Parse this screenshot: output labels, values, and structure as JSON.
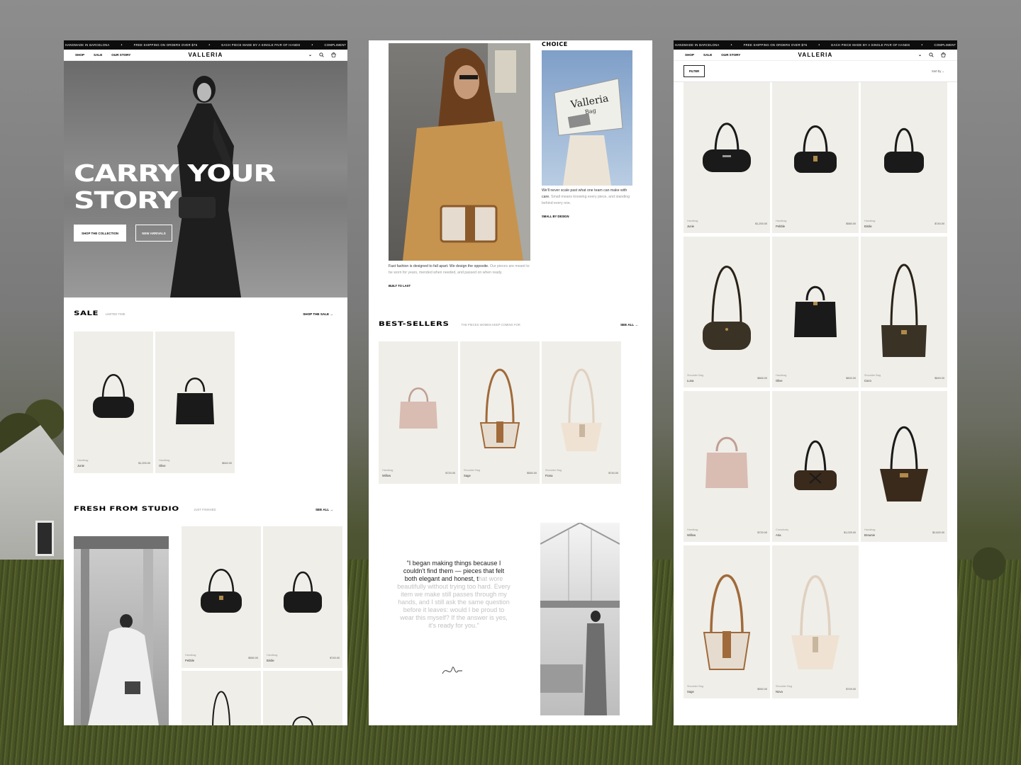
{
  "ticker": {
    "items": [
      "HANDMADE IN BARCELONA",
      "FREE SHIPPING ON ORDERS OVER $75",
      "EACH PIECE MADE BY A SINGLE PAIR OF HANDS",
      "COMPLIMENT"
    ],
    "sep": "•"
  },
  "nav": {
    "shop": "SHOP",
    "sale": "SALE",
    "our_story": "OUR STORY",
    "logo": "VALLERIA",
    "chev": "⌄"
  },
  "hero": {
    "headline_1": "CARRY YOUR",
    "headline_2": "STORY",
    "primary_cta": "SHOP THE COLLECTION",
    "secondary_cta": "NEW ARRIVALS"
  },
  "sale": {
    "title": "SALE",
    "subtitle": "LIMITED TIME",
    "link": "SHOP THE SALE",
    "products": [
      {
        "cat": "Handbag",
        "name": "Junie",
        "price": "$1,200.00"
      },
      {
        "cat": "Handbag",
        "name": "Olive",
        "price": "$640.00"
      }
    ]
  },
  "fresh": {
    "title": "FRESH FROM STUDIO",
    "subtitle": "JUST FINISHED",
    "link": "SEE ALL",
    "products": [
      {
        "cat": "Handbag",
        "name": "Pebble",
        "price": "$580.00"
      },
      {
        "cat": "Handbag",
        "name": "Birdie",
        "price": "$740.00"
      }
    ]
  },
  "story": {
    "choice": "CHOICE",
    "caption_left_dark": "Fast fashion is designed to fall apart. We design the opposite.",
    "caption_left_muted": "Our pieces are meant to be worn for years, mended when needed, and passed on when ready.",
    "tag_left": "BUILT TO LAST",
    "caption_right_dark": "We'll never scale past what one team can make with care.",
    "caption_right_muted": "Small means knowing every piece, and standing behind every one.",
    "tag_right": "SMALL BY DESIGN",
    "paper_title": "Valleria",
    "paper_sub": "Bag"
  },
  "bestsellers": {
    "title": "BEST-SELLERS",
    "subtitle": "THE PIECES WOMEN KEEP COMING FOR",
    "link": "SEE ALL",
    "products": [
      {
        "cat": "Handbag",
        "name": "Willow",
        "price": "$720.00"
      },
      {
        "cat": "Shoulder Bag",
        "name": "Sage",
        "price": "$550.00"
      },
      {
        "cat": "Shoulder Bag",
        "name": "Fiona",
        "price": "$740.00"
      }
    ]
  },
  "quote": {
    "dark": "\"I began making things because I couldn't find them — pieces that felt both elegant and honest, t",
    "fade": "hat wore beautifully without trying too hard. Every item we make still passes through my hands, and I still ask the same question before it leaves: would I be proud to wear this myself? If the answer is yes, it's ready for you.\""
  },
  "catalog": {
    "filter": "FILTER",
    "sort": "Sort by",
    "products": [
      {
        "cat": "Handbag",
        "name": "Junie",
        "price": "$1,200.00"
      },
      {
        "cat": "Handbag",
        "name": "Pebble",
        "price": "$580.00"
      },
      {
        "cat": "Handbag",
        "name": "Birdie",
        "price": "$740.00"
      },
      {
        "cat": "Shoulder Bag",
        "name": "Luna",
        "price": "$865.00"
      },
      {
        "cat": "Handbag",
        "name": "Olive",
        "price": "$600.00"
      },
      {
        "cat": "Shoulder Bag",
        "name": "Coco",
        "price": "$849.00"
      },
      {
        "cat": "Handbag",
        "name": "Willow",
        "price": "$720.00"
      },
      {
        "cat": "Crossbody",
        "name": "Aria",
        "price": "$1,025.00"
      },
      {
        "cat": "Handbag",
        "name": "Brownie",
        "price": "$2,620.00"
      },
      {
        "cat": "Shoulder Bag",
        "name": "Sage",
        "price": "$550.00"
      },
      {
        "cat": "Shoulder Bag",
        "name": "Nova",
        "price": "$749.00"
      }
    ]
  },
  "colors": {
    "ink": "#0d0d0d",
    "card_bg": "#efeee9",
    "black_bag": "#1a1a1a",
    "brown_bag": "#3a2a1c",
    "pink_bag": "#d9bcb2",
    "cream_bag": "#efe2d2",
    "tan": "#a06a3a"
  }
}
